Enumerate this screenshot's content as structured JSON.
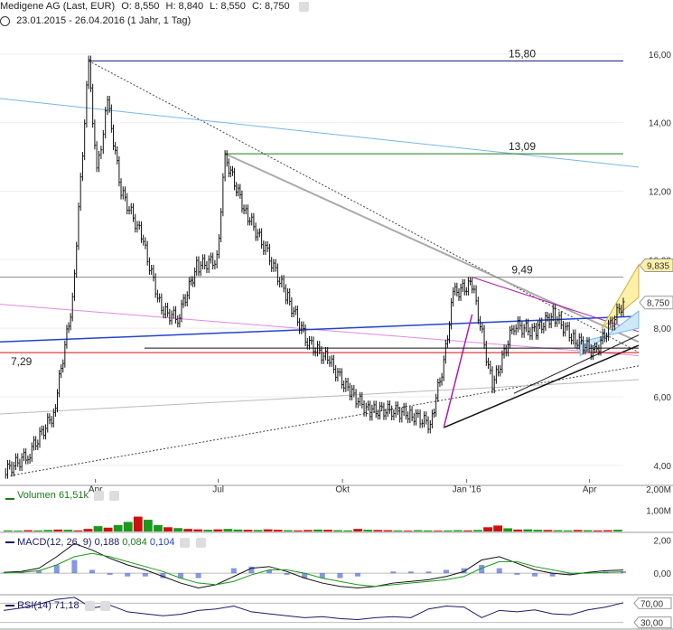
{
  "header": {
    "title": "Medigene AG (Last, EUR)",
    "open": "O: 8,550",
    "high": "H: 8,840",
    "low": "L: 8,550",
    "close": "C: 8,750",
    "range": "23.01.2015 - 26.04.2016 (1 Jahr, 1 Tag)"
  },
  "colors": {
    "up": "#1a9a1a",
    "down": "#cc1111",
    "blue": "#2244cc",
    "dark_blue": "#0a1a7a",
    "green_line": "#1a7a1a",
    "light_blue": "#77b7e8",
    "pink": "#e08ae0",
    "magenta": "#b01cb0",
    "red_line": "#d01010",
    "gray": "#999999",
    "yellow": "#fff0a8"
  },
  "chart_data": [
    {
      "type": "line",
      "name": "price",
      "x": [
        "2015-01-23",
        "2015-02-10",
        "2015-03-01",
        "2015-03-15",
        "2015-03-27",
        "2015-04-02",
        "2015-04-10",
        "2015-04-20",
        "2015-05-05",
        "2015-05-20",
        "2015-06-01",
        "2015-06-15",
        "2015-06-30",
        "2015-07-06",
        "2015-07-20",
        "2015-08-05",
        "2015-08-20",
        "2015-09-05",
        "2015-09-20",
        "2015-10-05",
        "2015-10-20",
        "2015-11-05",
        "2015-11-20",
        "2015-12-05",
        "2015-12-15",
        "2015-12-22",
        "2016-01-05",
        "2016-01-20",
        "2016-02-05",
        "2016-02-20",
        "2016-03-05",
        "2016-03-20",
        "2016-04-05",
        "2016-04-15",
        "2016-04-26"
      ],
      "y": [
        3.8,
        4.3,
        5.5,
        8.8,
        15.8,
        12.5,
        14.6,
        12.0,
        10.7,
        8.5,
        8.3,
        9.8,
        10.0,
        13.0,
        11.5,
        10.3,
        9.0,
        7.6,
        7.1,
        6.2,
        5.6,
        5.6,
        5.5,
        5.2,
        7.0,
        9.0,
        9.3,
        6.3,
        8.1,
        7.9,
        8.4,
        7.7,
        7.3,
        8.0,
        8.75
      ],
      "ylim": [
        3.6,
        16.6
      ],
      "y_ticks": [
        "4,00",
        "6,00",
        "8,00",
        "10,00",
        "12,00",
        "14,00",
        "16,00"
      ],
      "x_ticks": [
        "Apr",
        "Jul",
        "Okt",
        "Jan '16",
        "Apr"
      ],
      "levels": [
        {
          "value": 15.8,
          "label": "15,80"
        },
        {
          "value": 13.09,
          "label": "13,09"
        },
        {
          "value": 9.49,
          "label": "9,49"
        },
        {
          "value": 7.29,
          "label": "7,29"
        }
      ],
      "price_tags": [
        {
          "value": 9.835,
          "label": "9,835"
        },
        {
          "value": 8.75,
          "label": "8,750"
        }
      ]
    },
    {
      "type": "bar",
      "name": "Volumen",
      "value_label": "61,51k",
      "y_ticks": [
        "1,00M",
        "2,00M"
      ],
      "values": [
        0.05,
        0.04,
        0.06,
        0.05,
        0.07,
        0.09,
        0.08,
        0.05,
        0.12,
        0.25,
        0.18,
        0.3,
        0.45,
        0.7,
        0.55,
        0.3,
        0.2,
        0.16,
        0.12,
        0.1,
        0.08,
        0.1,
        0.12,
        0.09,
        0.08,
        0.07,
        0.1,
        0.08,
        0.06,
        0.05,
        0.07,
        0.09,
        0.08,
        0.06,
        0.05,
        0.12,
        0.08,
        0.07,
        0.06,
        0.05,
        0.04,
        0.06,
        0.05,
        0.04,
        0.05,
        0.06,
        0.05,
        0.07,
        0.2,
        0.28,
        0.15,
        0.09,
        0.1,
        0.08,
        0.07,
        0.06,
        0.05,
        0.07,
        0.06,
        0.05,
        0.06,
        0.08
      ]
    },
    {
      "type": "line",
      "name": "MACD(12, 26, 9)",
      "values_label": [
        "0,188",
        "0,084",
        "0,104"
      ],
      "y_ticks": [
        "0,00",
        "2,00"
      ],
      "macd": [
        0.05,
        0.1,
        0.3,
        1.0,
        1.8,
        1.4,
        0.9,
        0.5,
        0.2,
        -0.2,
        -0.6,
        -0.9,
        -0.7,
        -0.2,
        0.3,
        0.4,
        0.1,
        -0.3,
        -0.6,
        -0.8,
        -0.9,
        -0.8,
        -0.6,
        -0.5,
        -0.4,
        -0.2,
        0.1,
        0.8,
        1.0,
        0.6,
        0.2,
        0.0,
        -0.1,
        0.05,
        0.15,
        0.19
      ],
      "signal": [
        0.02,
        0.05,
        0.15,
        0.5,
        1.0,
        1.2,
        1.0,
        0.7,
        0.4,
        0.1,
        -0.3,
        -0.6,
        -0.7,
        -0.5,
        -0.1,
        0.2,
        0.2,
        0.0,
        -0.3,
        -0.5,
        -0.7,
        -0.8,
        -0.7,
        -0.6,
        -0.5,
        -0.4,
        -0.2,
        0.3,
        0.7,
        0.7,
        0.4,
        0.2,
        0.0,
        0.0,
        0.05,
        0.08
      ]
    },
    {
      "type": "line",
      "name": "RSI(14)",
      "value_label": "71,18",
      "ylim": [
        30,
        70
      ],
      "y_ticks": [
        "70,00",
        "30,00"
      ],
      "values": [
        55,
        60,
        68,
        78,
        82,
        60,
        66,
        52,
        48,
        44,
        47,
        55,
        58,
        64,
        52,
        48,
        44,
        40,
        42,
        38,
        36,
        40,
        42,
        40,
        58,
        64,
        62,
        40,
        55,
        52,
        56,
        48,
        46,
        56,
        62,
        71
      ]
    }
  ]
}
